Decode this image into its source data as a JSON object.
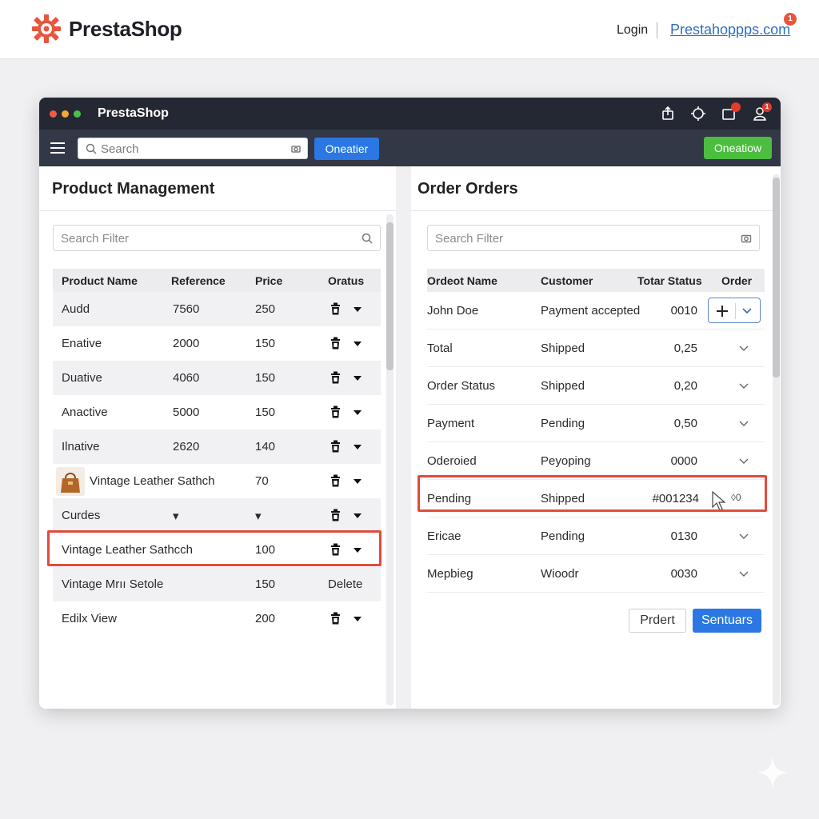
{
  "site_header": {
    "brand": "PrestaShop",
    "login": "Login",
    "site_link": "Prestahoppps.com",
    "notification_count": "1"
  },
  "window": {
    "title": "PrestaShop",
    "notification_count": "1"
  },
  "toolbar": {
    "search_placeholder": "Search",
    "blue_button": "Oneatier",
    "green_button": "Oneatiow"
  },
  "product_panel": {
    "title": "Product Management",
    "filter_placeholder": "Search Filter",
    "columns": [
      "Product Name",
      "Reference",
      "Price",
      "Oratus"
    ],
    "rows": [
      {
        "name": "Audd",
        "ref": "7560",
        "price": "250",
        "action": "trash",
        "caret": true
      },
      {
        "name": "Enative",
        "ref": "2000",
        "price": "150",
        "action": "trash",
        "caret": true
      },
      {
        "name": "Duative",
        "ref": "4060",
        "price": "150",
        "action": "trash",
        "caret": true
      },
      {
        "name": "Anactive",
        "ref": "5000",
        "price": "150",
        "action": "trash",
        "caret": true
      },
      {
        "name": "Ilnative",
        "ref": "2620",
        "price": "140",
        "action": "trash",
        "caret": true
      },
      {
        "name": "Vintage Leather Sathch",
        "ref": "",
        "price": "70",
        "action": "trash",
        "caret": true,
        "thumb": "leather-bag"
      },
      {
        "name": "Curdes",
        "ref": "▾",
        "price": "▾",
        "action": "trash",
        "caret": true
      },
      {
        "name": "Vintage Leather Sathcch",
        "ref": "",
        "price": "100",
        "action": "trash",
        "caret": true,
        "highlighted": true
      },
      {
        "name": "Vintage Mrıı Setole",
        "ref": "",
        "price": "150",
        "action": "Delete",
        "caret": false
      },
      {
        "name": "Edilx View",
        "ref": "",
        "price": "200",
        "action": "trash",
        "caret": true
      }
    ]
  },
  "order_panel": {
    "title": "Order Orders",
    "filter_placeholder": "Search Filter",
    "columns": [
      "Ordeot Name",
      "Customer",
      "Totar Status",
      "Order"
    ],
    "rows": [
      {
        "name": "John Doe",
        "status": "Payment accepted",
        "total": "0010",
        "control": "add"
      },
      {
        "name": "Total",
        "status": "Shipped",
        "total": "0,25",
        "control": "chevron"
      },
      {
        "name": "Order Status",
        "status": "Shipped",
        "total": "0,20",
        "control": "chevron"
      },
      {
        "name": "Payment",
        "status": "Pending",
        "total": "0,50",
        "control": "chevron"
      },
      {
        "name": "Oderoied",
        "status": "Peyoping",
        "total": "0000",
        "control": "chevron"
      },
      {
        "name": "Pending",
        "status": "Shipped",
        "total": "#001234",
        "control": "view",
        "highlighted": true,
        "view_label": "◊0"
      },
      {
        "name": "Ericae",
        "status": "Pending",
        "total": "0130",
        "control": "chevron"
      },
      {
        "name": "Mepbieg",
        "status": "Wioodr",
        "total": "0030",
        "control": "chevron"
      }
    ],
    "secondary_button": "Prdert",
    "primary_button": "Sentuars"
  },
  "colors": {
    "brand_orange": "#e8553c",
    "accent_blue": "#2b78e4",
    "accent_green": "#4bbd3f",
    "titlebar": "#242832",
    "highlight_red": "#e14b3c"
  }
}
